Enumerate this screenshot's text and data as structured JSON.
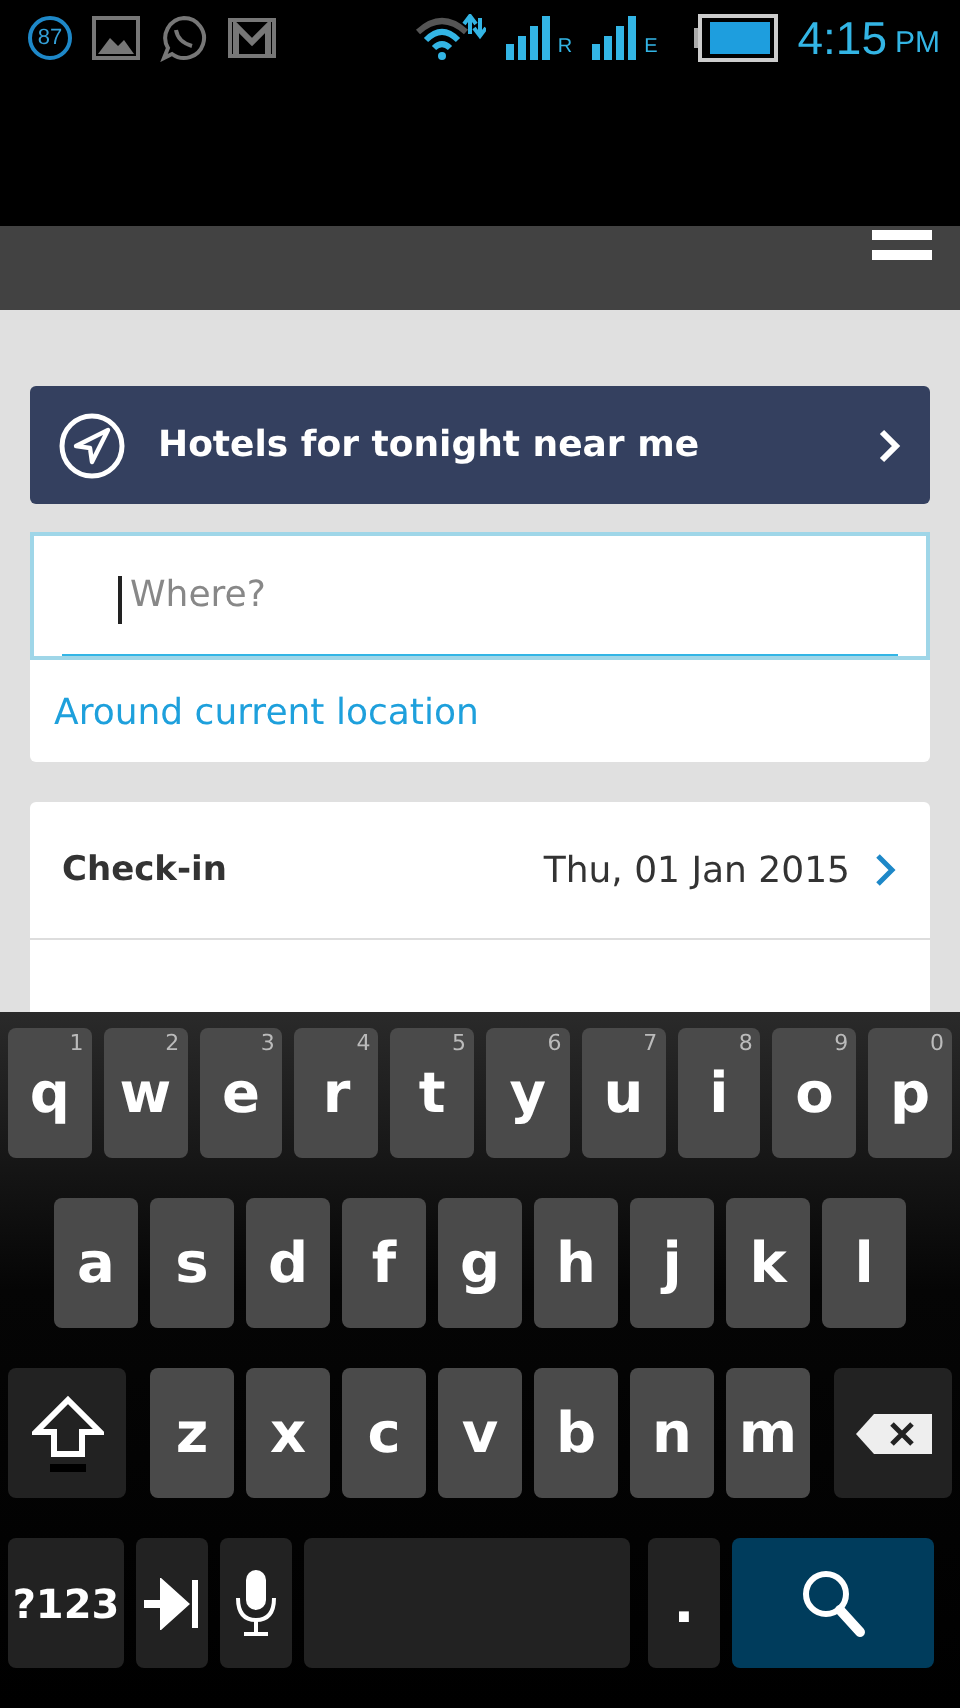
{
  "status_bar": {
    "badge": "87",
    "network_1": "R",
    "network_2": "E",
    "time": "4:15",
    "ampm": "PM"
  },
  "banner": {
    "label": "Hotels for tonight near me"
  },
  "search": {
    "placeholder": "Where?",
    "focused": true
  },
  "location_link": "Around current location",
  "dates": [
    {
      "label": "Check-in",
      "value": "Thu, 01 Jan 2015"
    }
  ],
  "keyboard": {
    "rows": [
      [
        {
          "kind": "letter",
          "label": "q",
          "hint": "1"
        },
        {
          "kind": "letter",
          "label": "w",
          "hint": "2"
        },
        {
          "kind": "letter",
          "label": "e",
          "hint": "3"
        },
        {
          "kind": "letter",
          "label": "r",
          "hint": "4"
        },
        {
          "kind": "letter",
          "label": "t",
          "hint": "5"
        },
        {
          "kind": "letter",
          "label": "y",
          "hint": "6"
        },
        {
          "kind": "letter",
          "label": "u",
          "hint": "7"
        },
        {
          "kind": "letter",
          "label": "i",
          "hint": "8"
        },
        {
          "kind": "letter",
          "label": "o",
          "hint": "9"
        },
        {
          "kind": "letter",
          "label": "p",
          "hint": "0"
        }
      ],
      [
        {
          "kind": "letter",
          "label": "a"
        },
        {
          "kind": "letter",
          "label": "s"
        },
        {
          "kind": "letter",
          "label": "d"
        },
        {
          "kind": "letter",
          "label": "f"
        },
        {
          "kind": "letter",
          "label": "g"
        },
        {
          "kind": "letter",
          "label": "h"
        },
        {
          "kind": "letter",
          "label": "j"
        },
        {
          "kind": "letter",
          "label": "k"
        },
        {
          "kind": "letter",
          "label": "l"
        }
      ],
      [
        {
          "kind": "shift"
        },
        {
          "kind": "letter",
          "label": "z"
        },
        {
          "kind": "letter",
          "label": "x"
        },
        {
          "kind": "letter",
          "label": "c"
        },
        {
          "kind": "letter",
          "label": "v"
        },
        {
          "kind": "letter",
          "label": "b"
        },
        {
          "kind": "letter",
          "label": "n"
        },
        {
          "kind": "letter",
          "label": "m"
        },
        {
          "kind": "backspace"
        }
      ],
      [
        {
          "kind": "mode",
          "label": "?123"
        },
        {
          "kind": "tab"
        },
        {
          "kind": "mic"
        },
        {
          "kind": "space"
        },
        {
          "kind": "period",
          "label": "."
        },
        {
          "kind": "search"
        }
      ]
    ]
  }
}
